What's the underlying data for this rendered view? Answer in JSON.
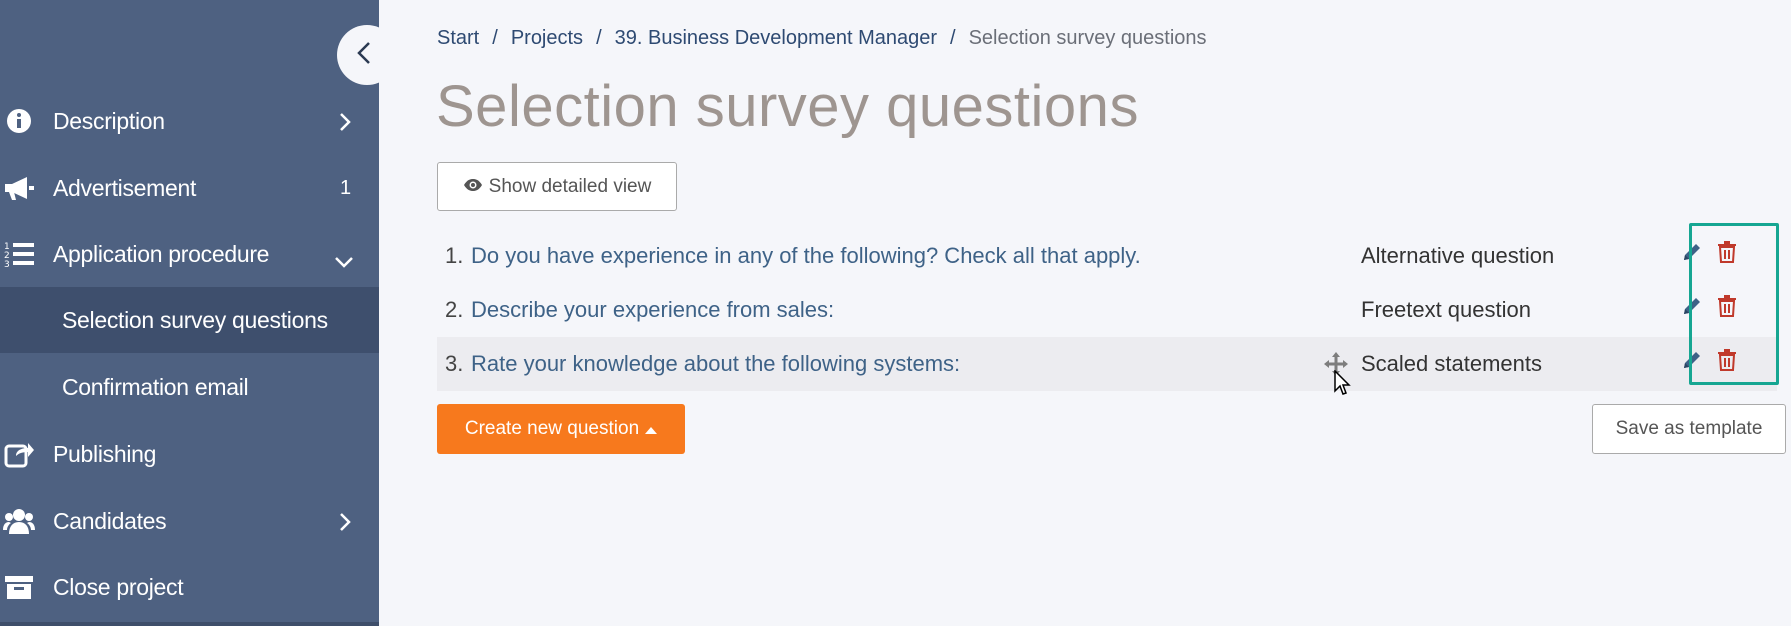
{
  "sidebar": {
    "items": [
      {
        "label": "Description",
        "icon": "info-icon"
      },
      {
        "label": "Advertisement",
        "icon": "megaphone-icon",
        "count": "1"
      },
      {
        "label": "Application procedure",
        "icon": "list-icon"
      },
      {
        "label": "Selection survey questions"
      },
      {
        "label": "Confirmation email"
      },
      {
        "label": "Publishing",
        "icon": "share-icon"
      },
      {
        "label": "Candidates",
        "icon": "users-icon"
      },
      {
        "label": "Close project",
        "icon": "archive-icon"
      }
    ]
  },
  "breadcrumb": {
    "items": [
      "Start",
      "Projects",
      "39. Business Development Manager"
    ],
    "separator": "/",
    "current": "Selection survey questions"
  },
  "page": {
    "title": "Selection survey questions",
    "show_detail_label": "Show detailed view"
  },
  "questions": [
    {
      "num": "1.",
      "text": "Do you have experience in any of the following? Check all that apply.",
      "type": "Alternative question"
    },
    {
      "num": "2.",
      "text": "Describe your experience from sales:",
      "type": "Freetext question"
    },
    {
      "num": "3.",
      "text": "Rate your knowledge about the following systems:",
      "type": "Scaled statements"
    }
  ],
  "actions": {
    "create_label": "Create new question",
    "template_label": "Save as template"
  },
  "colors": {
    "sidebar_bg": "#4e6181",
    "accent_orange": "#f7791d",
    "highlight": "#16a692",
    "delete_red": "#c0392b",
    "link_blue": "#3e6287"
  }
}
